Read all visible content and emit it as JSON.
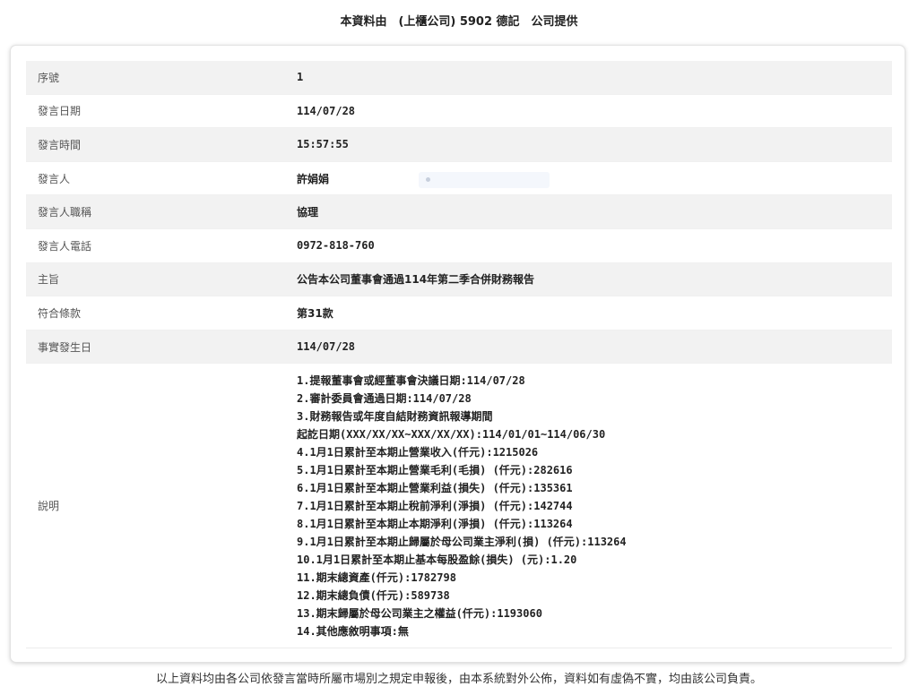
{
  "header": {
    "title": "本資料由　(上櫃公司) 5902 德記　公司提供"
  },
  "fields": [
    {
      "label": "序號",
      "value": "1"
    },
    {
      "label": "發言日期",
      "value": "114/07/28"
    },
    {
      "label": "發言時間",
      "value": "15:57:55"
    },
    {
      "label": "發言人",
      "value": "許娟娟"
    },
    {
      "label": "發言人職稱",
      "value": "協理"
    },
    {
      "label": "發言人電話",
      "value": "0972-818-760"
    },
    {
      "label": "主旨",
      "value": "公告本公司董事會通過114年第二季合併財務報告"
    },
    {
      "label": "符合條款",
      "value": "第31款"
    },
    {
      "label": "事實發生日",
      "value": "114/07/28"
    }
  ],
  "description": {
    "label": "說明",
    "lines": [
      "1.提報董事會或經董事會決議日期:114/07/28",
      "2.審計委員會通過日期:114/07/28",
      "3.財務報告或年度自結財務資訊報導期間",
      "起訖日期(XXX/XX/XX~XXX/XX/XX):114/01/01~114/06/30",
      "4.1月1日累計至本期止營業收入(仟元):1215026",
      "5.1月1日累計至本期止營業毛利(毛損) (仟元):282616",
      "6.1月1日累計至本期止營業利益(損失) (仟元):135361",
      "7.1月1日累計至本期止稅前淨利(淨損) (仟元):142744",
      "8.1月1日累計至本期止本期淨利(淨損) (仟元):113264",
      "9.1月1日累計至本期止歸屬於母公司業主淨利(損) (仟元):113264",
      "10.1月1日累計至本期止基本每股盈餘(損失) (元):1.20",
      "11.期末總資產(仟元):1782798",
      "12.期末總負債(仟元):589738",
      "13.期末歸屬於母公司業主之權益(仟元):1193060",
      "14.其他應敘明事項:無"
    ]
  },
  "footer": {
    "text": "以上資料均由各公司依發言當時所屬市場別之規定申報後，由本系統對外公佈，資料如有虛偽不實，均由該公司負責。"
  }
}
